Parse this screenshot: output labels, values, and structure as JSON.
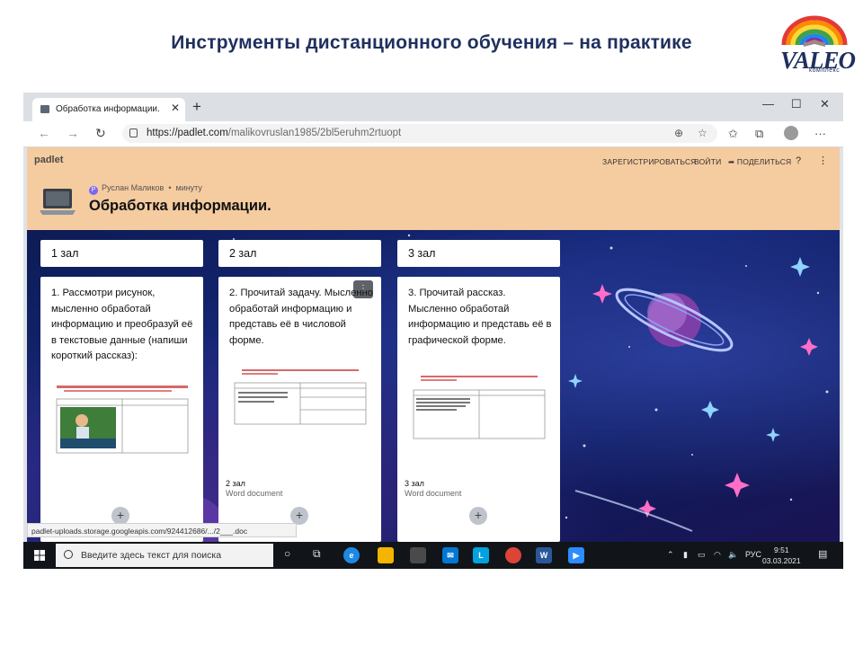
{
  "slide": {
    "title": "Инструменты дистанционного обучения – на практике",
    "logo_text": "VALEO",
    "logo_sub": "комплекс"
  },
  "browser": {
    "tab_title": "Обработка информации.",
    "url_host": "https://padlet.com",
    "url_path": "/malikovruslan1985/2bl5eruhm2rtuopt"
  },
  "padlet": {
    "brand": "padlet",
    "header_links": [
      "ЗАРЕГИСТРИРОВАТЬСЯ",
      "ВОЙТИ",
      "ПОДЕЛИТЬСЯ"
    ],
    "author_initial": "Р",
    "author": "Руслан Маликов",
    "time": "минуту",
    "title": "Обработка информации.",
    "background_color": "#13246f",
    "header_color": "#f5cba0",
    "columns": [
      {
        "title": "1 зал",
        "card_text": "1. Рассмотри рисунок, мысленно обработай информацию и преобразуй её в текстовые данные (напиши короткий рассказ):",
        "doc_heading": "Рассмотри рисунок, мысленно обработай информацию и преобразуй её в текстовые данные (напиши короткий рассказ)",
        "doc_col1": "Графическая информация",
        "doc_col2": "Текстовая информация",
        "foot": "",
        "foot2": ""
      },
      {
        "title": "2 зал",
        "card_text": "2. Прочитай задачу. Мысленно обработай информацию и представь её в числовой форме.",
        "doc_heading": "Прочитай задачу. Мысленно обработай информацию и представь её в числовой форме.",
        "doc_col1": "Текстовые данные",
        "doc_col2": "Числовые данные",
        "doc_cell_text": "В зале 2 кресла, а стульев в 8 раз больше. Сколько стульев и кресел в зале?",
        "doc_answers": [
          "1)",
          "2)",
          "Ответ:"
        ],
        "foot": "2 зал",
        "foot2": "Word document"
      },
      {
        "title": "3 зал",
        "card_text": "3. Прочитай рассказ. Мысленно обработай информацию и представь её в графической форме.",
        "doc_heading": "Прочитай рассказ. Мысленно обработай информацию и представь её в графической форме.",
        "doc_col1": "Текстовые данные",
        "doc_col2": "Графические данные",
        "doc_cell_text": "На улице ярко светило солнце. Рабочие строили дом новый самый новый дом. Когда его построят, я посажу возле него цветы.",
        "foot": "3 зал",
        "foot2": "Word document"
      }
    ],
    "status_url": "padlet-uploads.storage.googleapis.com/924412686/.../2___.doc"
  },
  "taskbar": {
    "search_placeholder": "Введите здесь текст для поиска",
    "lang": "РУС",
    "time": "9:51",
    "date": "03.03.2021"
  }
}
